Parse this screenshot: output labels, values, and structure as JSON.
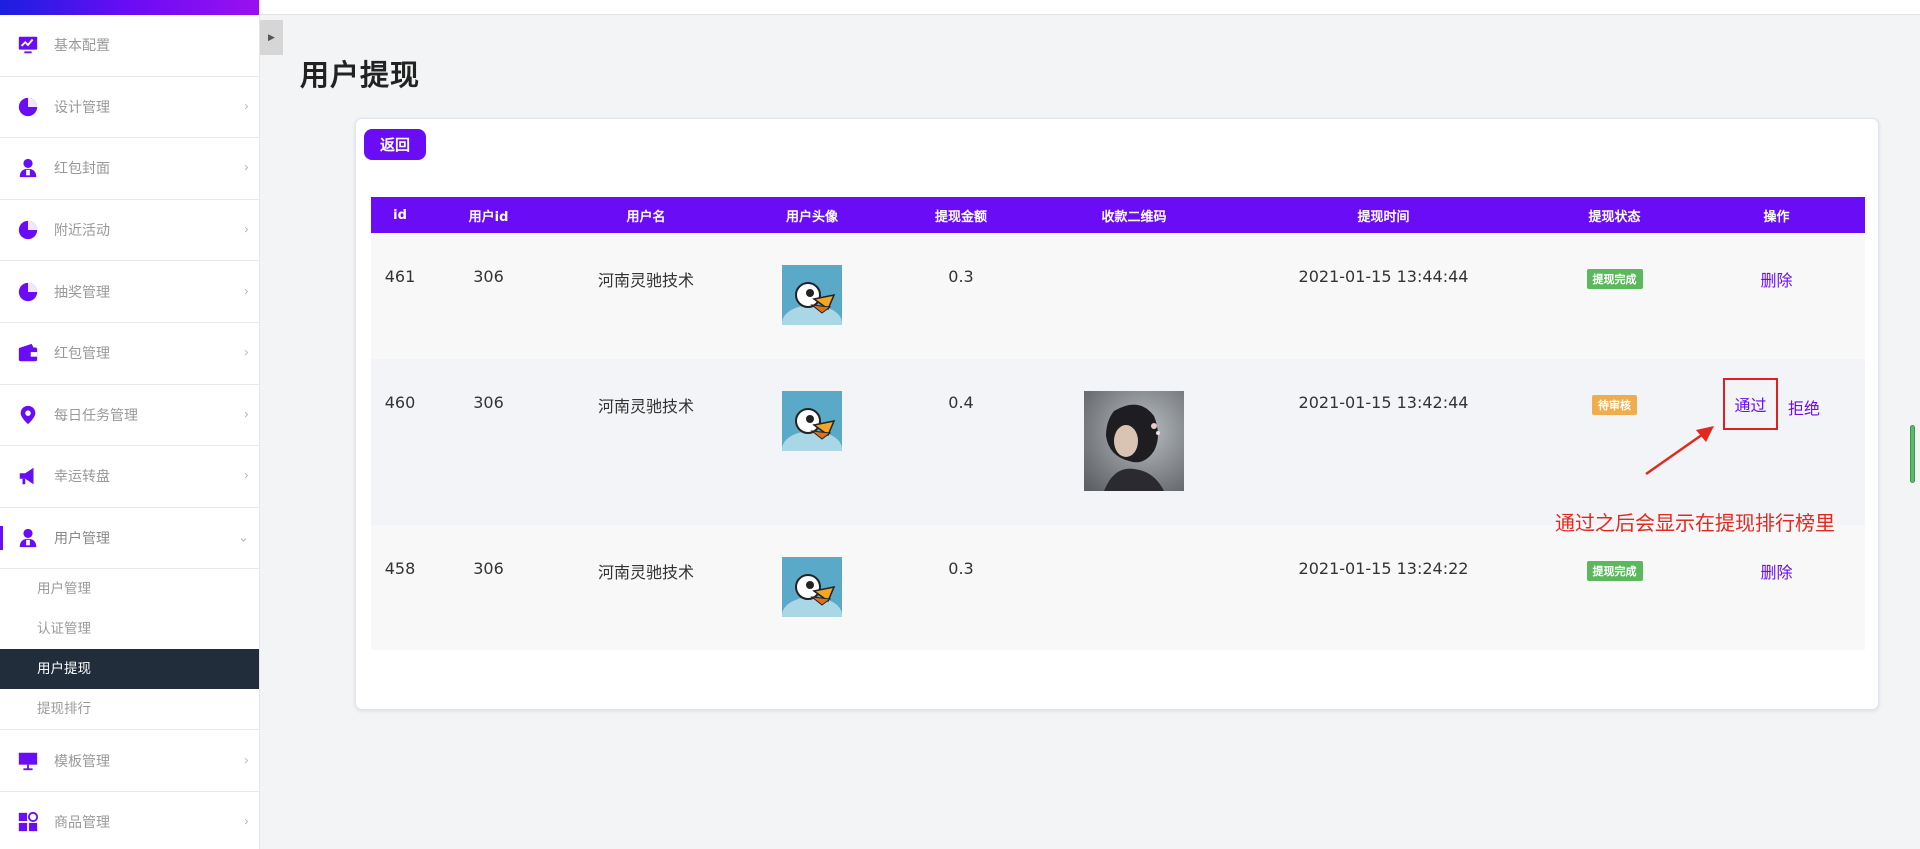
{
  "sidebar": {
    "items": [
      {
        "label": "基本配置",
        "icon": "monitor-chart-icon",
        "has_arrow": false
      },
      {
        "label": "设计管理",
        "icon": "pie-chart-icon",
        "has_arrow": true
      },
      {
        "label": "红包封面",
        "icon": "user-icon",
        "has_arrow": true
      },
      {
        "label": "附近活动",
        "icon": "pie-chart-icon",
        "has_arrow": true
      },
      {
        "label": "抽奖管理",
        "icon": "pie-chart-icon",
        "has_arrow": true
      },
      {
        "label": "红包管理",
        "icon": "wallet-icon",
        "has_arrow": true
      },
      {
        "label": "每日任务管理",
        "icon": "map-pin-icon",
        "has_arrow": true
      },
      {
        "label": "幸运转盘",
        "icon": "megaphone-icon",
        "has_arrow": true
      },
      {
        "label": "用户管理",
        "icon": "user-icon",
        "has_arrow": true,
        "expanded": true
      }
    ],
    "submenu": [
      {
        "label": "用户管理"
      },
      {
        "label": "认证管理"
      },
      {
        "label": "用户提现",
        "active": true
      },
      {
        "label": "提现排行"
      }
    ],
    "items_after": [
      {
        "label": "模板管理",
        "icon": "presentation-icon"
      },
      {
        "label": "商品管理",
        "icon": "apps-icon"
      }
    ],
    "arrow_glyph": "›",
    "expanded_glyph": "⌄"
  },
  "page": {
    "title": "用户提现",
    "back_label": "返回"
  },
  "table": {
    "headers": [
      "id",
      "用户id",
      "用户名",
      "用户头像",
      "提现金额",
      "收款二维码",
      "提现时间",
      "提现状态",
      "操作"
    ],
    "rows": [
      {
        "id": "461",
        "user_id": "306",
        "username": "河南灵驰技术",
        "amount": "0.3",
        "time": "2021-01-15 13:44:44",
        "status": "提现完成",
        "op": "删除"
      },
      {
        "id": "460",
        "user_id": "306",
        "username": "河南灵驰技术",
        "amount": "0.4",
        "time": "2021-01-15 13:42:44",
        "status": "待审核",
        "op_approve": "通过",
        "op_reject": "拒绝"
      },
      {
        "id": "458",
        "user_id": "306",
        "username": "河南灵驰技术",
        "amount": "0.3",
        "time": "2021-01-15 13:24:22",
        "status": "提现完成",
        "op": "删除"
      }
    ]
  },
  "annotation": {
    "text": "通过之后会显示在提现排行榜里"
  },
  "colors": {
    "accent": "#6a0cf5",
    "success": "#5cb85c",
    "warning": "#f0ad4e",
    "annotation": "#e12a1f",
    "sidebar_active_bg": "#212d3b"
  }
}
